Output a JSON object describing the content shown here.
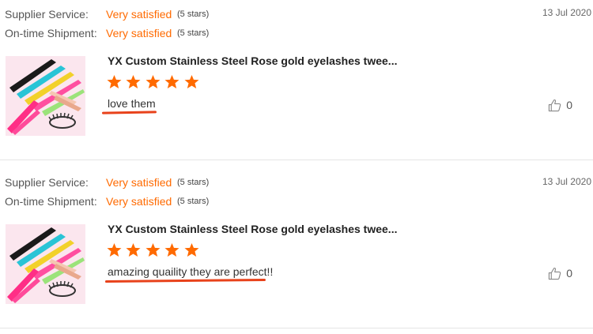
{
  "reviews": [
    {
      "supplier_label": "Supplier Service:",
      "supplier_value": "Very satisfied",
      "supplier_stars": "(5 stars)",
      "shipment_label": "On-time Shipment:",
      "shipment_value": "Very satisfied",
      "shipment_stars": "(5 stars)",
      "date": "13 Jul 2020",
      "product_title": "YX Custom Stainless Steel Rose gold eyelashes twee...",
      "rating": 5,
      "comment": "love them",
      "likes": "0",
      "thumb_icon": "tweezers-product-icon"
    },
    {
      "supplier_label": "Supplier Service:",
      "supplier_value": "Very satisfied",
      "supplier_stars": "(5 stars)",
      "shipment_label": "On-time Shipment:",
      "shipment_value": "Very satisfied",
      "shipment_stars": "(5 stars)",
      "date": "13 Jul 2020",
      "product_title": "YX Custom Stainless Steel Rose gold eyelashes twee...",
      "rating": 5,
      "comment": "amazing quaility they are perfect!!",
      "likes": "0",
      "thumb_icon": "tweezers-product-icon"
    }
  ],
  "colors": {
    "accent": "#ff6a00",
    "star": "#ff6a00",
    "annotation_underline": "#e8421b"
  },
  "icons": {
    "star": "star-icon",
    "like": "thumbs-up-icon"
  }
}
